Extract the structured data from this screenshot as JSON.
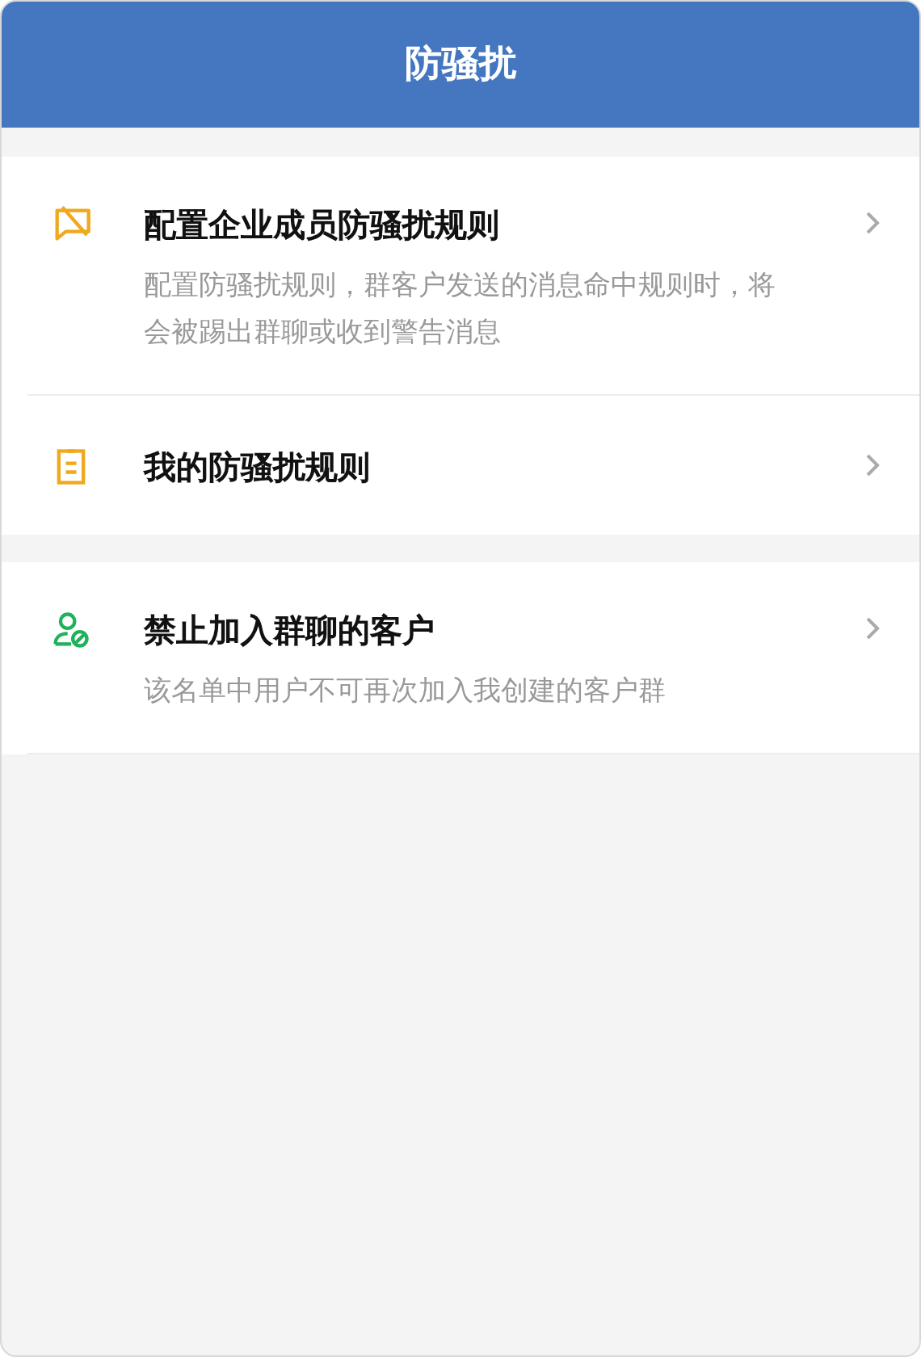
{
  "header": {
    "title": "防骚扰"
  },
  "sections": [
    {
      "items": [
        {
          "kind": "chat-off",
          "color": "#f0a81c",
          "title": "配置企业成员防骚扰规则",
          "description": "配置防骚扰规则，群客户发送的消息命中规则时，将会被踢出群聊或收到警告消息"
        },
        {
          "kind": "clipboard",
          "color": "#f0a81c",
          "title": "我的防骚扰规则"
        }
      ]
    },
    {
      "items": [
        {
          "kind": "user-block",
          "color": "#1fb25a",
          "title": "禁止加入群聊的客户",
          "description": "该名单中用户不可再次加入我创建的客户群"
        }
      ]
    }
  ]
}
